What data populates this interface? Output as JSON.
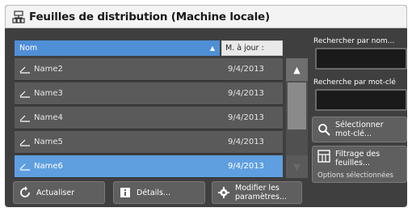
{
  "window": {
    "title": "Feuilles de distribution (Machine locale)"
  },
  "table": {
    "col_name": "Nom",
    "col_date": "M. à jour :",
    "rows": [
      {
        "name": "Name2",
        "date": "9/4/2013",
        "selected": false
      },
      {
        "name": "Name3",
        "date": "9/4/2013",
        "selected": false
      },
      {
        "name": "Name4",
        "date": "9/4/2013",
        "selected": false
      },
      {
        "name": "Name5",
        "date": "9/4/2013",
        "selected": false
      },
      {
        "name": "Name6",
        "date": "9/4/2013",
        "selected": true
      }
    ]
  },
  "search": {
    "by_name_label": "Rechercher par nom...",
    "by_keyword_label": "Recherche par mot-clé"
  },
  "buttons": {
    "select_keyword": "Sélectionner mot-clé...",
    "filter": "Filtrage des feuilles...",
    "options_selected": "Options sélectionnées",
    "refresh": "Actualiser",
    "details": "Détails...",
    "modify": "Modifier les paramètres..."
  },
  "colors": {
    "selected_row": "#5f9fdf",
    "header_blue": "#4f8fd6",
    "panel_bg": "#3f3f40"
  }
}
